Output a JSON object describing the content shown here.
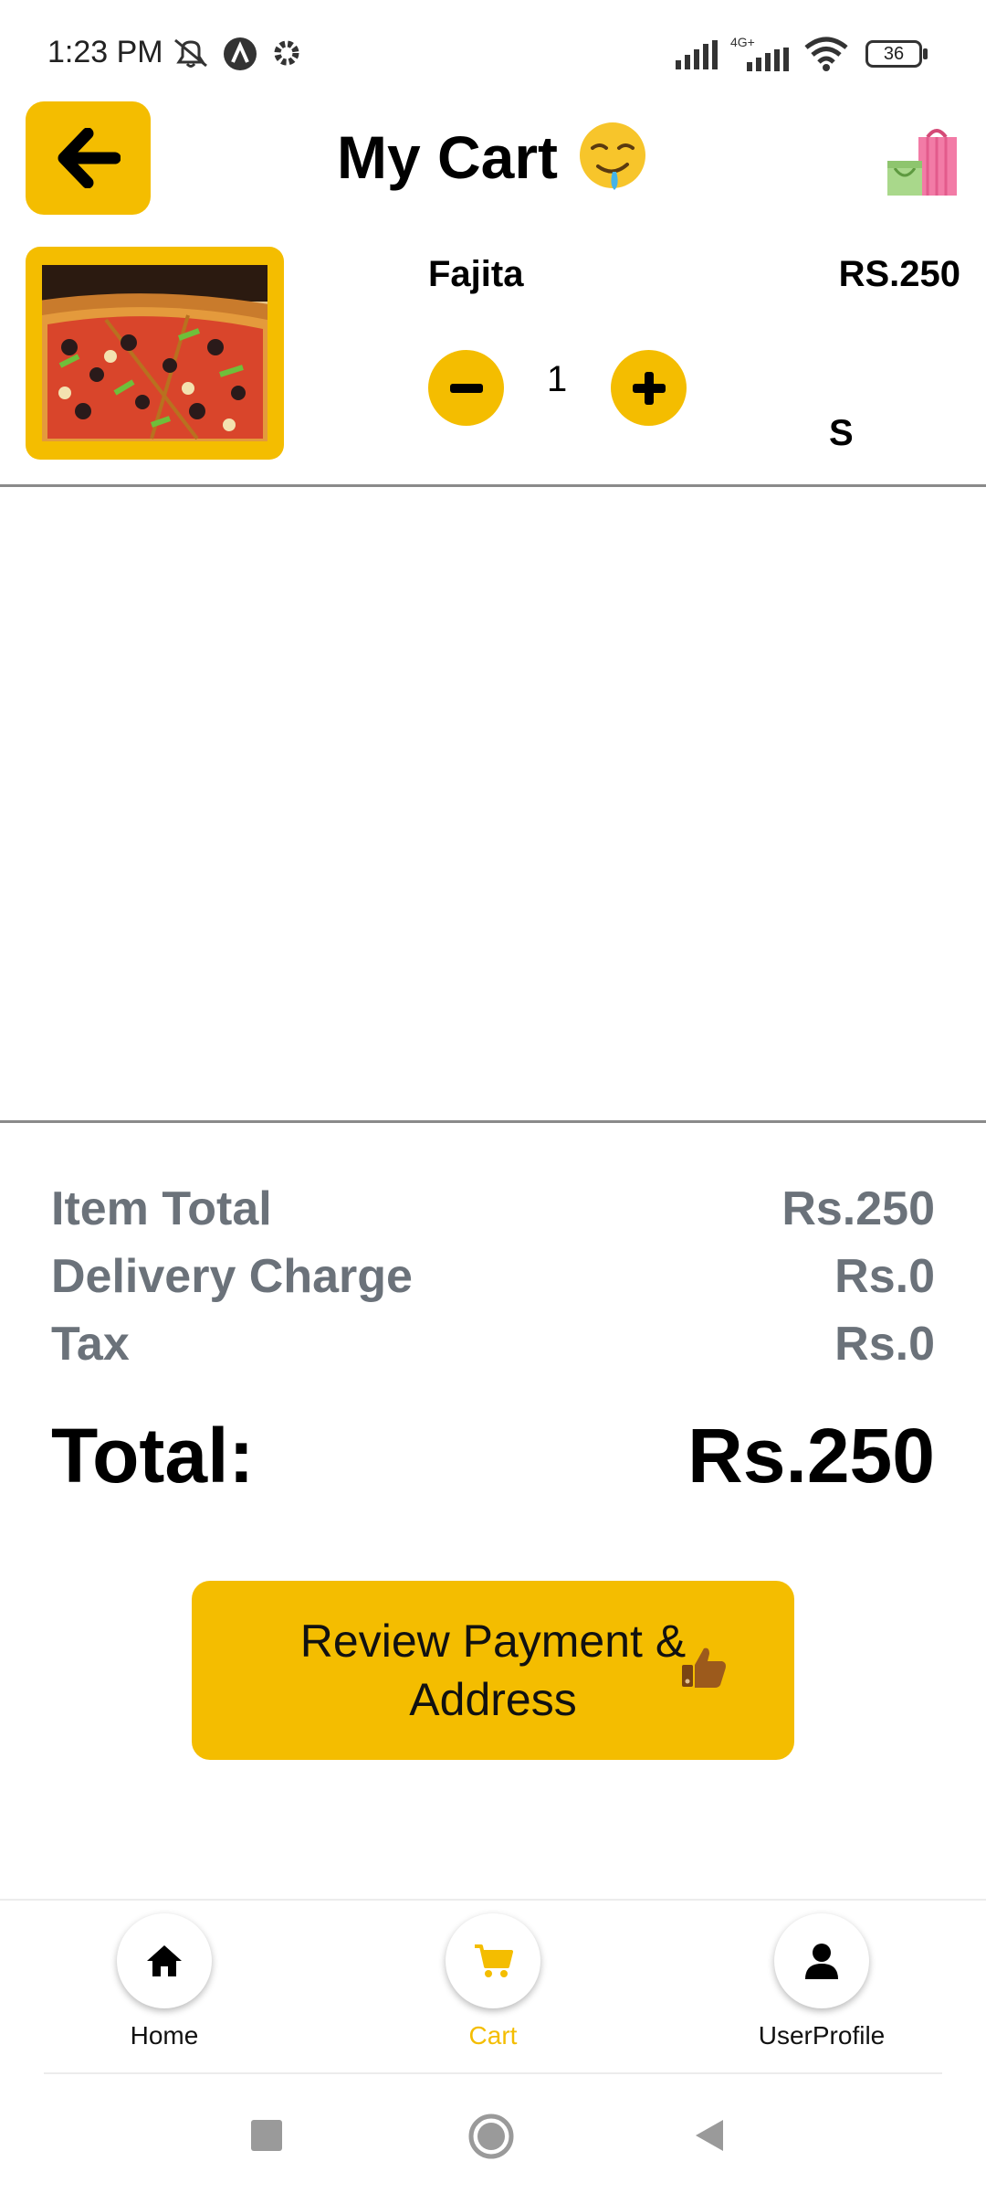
{
  "status_bar": {
    "time": "1:23 PM",
    "battery": "36",
    "network": "4G+"
  },
  "header": {
    "title": "My Cart",
    "title_emoji": "drooling-face",
    "back_icon": "arrow-left-icon",
    "bag_icon": "shopping-bags-icon"
  },
  "cart_items": [
    {
      "name": "Fajita",
      "price": "RS.250",
      "quantity": "1",
      "size": "S",
      "image": "pizza"
    }
  ],
  "summary": {
    "item_total_label": "Item Total",
    "item_total_value": "Rs.250",
    "delivery_label": "Delivery Charge",
    "delivery_value": "Rs.0",
    "tax_label": "Tax",
    "tax_value": "Rs.0",
    "total_label": "Total:",
    "total_value": "Rs.250"
  },
  "cta": {
    "label": "Review Payment & Address",
    "icon": "thumbs-up-icon"
  },
  "bottom_nav": [
    {
      "label": "Home",
      "icon": "home-icon",
      "active": false
    },
    {
      "label": "Cart",
      "icon": "cart-icon",
      "active": true
    },
    {
      "label": "UserProfile",
      "icon": "user-icon",
      "active": false
    }
  ],
  "colors": {
    "accent": "#F4BD00",
    "muted_text": "#6b727a",
    "divider": "#8a8a8a"
  }
}
